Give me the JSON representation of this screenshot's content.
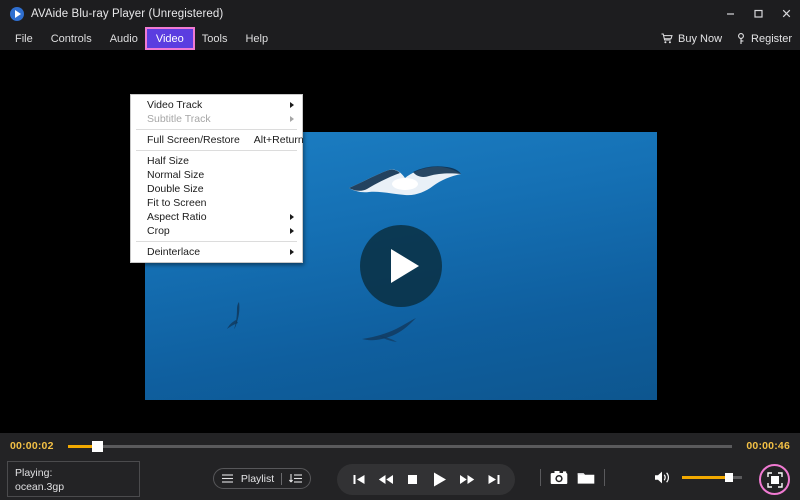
{
  "window": {
    "title": "AVAide Blu-ray Player (Unregistered)",
    "logo_icon": "play-logo-icon",
    "minimize_label": "–",
    "maximize_label": "□",
    "close_label": "✕"
  },
  "menubar": {
    "items": [
      {
        "label": "File",
        "active": false
      },
      {
        "label": "Controls",
        "active": false
      },
      {
        "label": "Audio",
        "active": false
      },
      {
        "label": "Video",
        "active": true
      },
      {
        "label": "Tools",
        "active": false
      },
      {
        "label": "Help",
        "active": false
      }
    ],
    "right_links": [
      {
        "label": "Buy Now",
        "icon": "cart-icon"
      },
      {
        "label": "Register",
        "icon": "key-icon"
      }
    ],
    "active_color": "#5b3de0",
    "highlight_color": "#f07ad2"
  },
  "video_menu": {
    "items": [
      {
        "label": "Video Track",
        "submenu": true,
        "disabled": false,
        "accel": ""
      },
      {
        "label": "Subtitle Track",
        "submenu": true,
        "disabled": true,
        "accel": ""
      },
      {
        "separator_after": true,
        "label": "",
        "submenu": false,
        "disabled": false,
        "accel": ""
      },
      {
        "label": "Full Screen/Restore",
        "submenu": false,
        "disabled": false,
        "accel": "Alt+Return"
      },
      {
        "separator_after": true,
        "label": "",
        "submenu": false,
        "disabled": false,
        "accel": ""
      },
      {
        "label": "Half Size",
        "submenu": false,
        "disabled": false,
        "accel": ""
      },
      {
        "label": "Normal Size",
        "submenu": false,
        "disabled": false,
        "accel": ""
      },
      {
        "label": "Double Size",
        "submenu": false,
        "disabled": false,
        "accel": ""
      },
      {
        "label": "Fit to Screen",
        "submenu": false,
        "disabled": false,
        "accel": ""
      },
      {
        "label": "Aspect Ratio",
        "submenu": true,
        "disabled": false,
        "accel": ""
      },
      {
        "label": "Crop",
        "submenu": true,
        "disabled": false,
        "accel": ""
      },
      {
        "separator_after": true,
        "label": "",
        "submenu": false,
        "disabled": false,
        "accel": ""
      },
      {
        "label": "Deinterlace",
        "submenu": true,
        "disabled": false,
        "accel": ""
      }
    ]
  },
  "stage": {
    "play_overlay_icon": "play-triangle-icon",
    "video_description": "seagulls-flying-blue-sky"
  },
  "seekbar": {
    "current_time": "00:00:02",
    "total_time": "00:00:46",
    "progress_percent": 4.3,
    "fill_color": "#f2a900"
  },
  "now_playing": {
    "status_label": "Playing:",
    "file_name": "ocean.3gp"
  },
  "playlist": {
    "label": "Playlist",
    "left_icon": "hamburger-icon",
    "right_icon": "playlist-sort-icon"
  },
  "transport": {
    "buttons": [
      {
        "name": "previous-track-button",
        "icon": "skip-back-icon"
      },
      {
        "name": "rewind-button",
        "icon": "rewind-icon"
      },
      {
        "name": "stop-button",
        "icon": "stop-icon"
      },
      {
        "name": "play-button",
        "icon": "play-icon"
      },
      {
        "name": "fast-forward-button",
        "icon": "fast-forward-icon"
      },
      {
        "name": "next-track-button",
        "icon": "skip-forward-icon"
      }
    ]
  },
  "capture": {
    "snapshot_icon": "camera-icon",
    "folder_icon": "folder-icon"
  },
  "volume": {
    "speaker_icon": "speaker-icon",
    "level_percent": 78,
    "fill_color": "#f2a900"
  },
  "fullscreen": {
    "icon": "fullscreen-icon",
    "highlight_color": "#f07ad2"
  }
}
